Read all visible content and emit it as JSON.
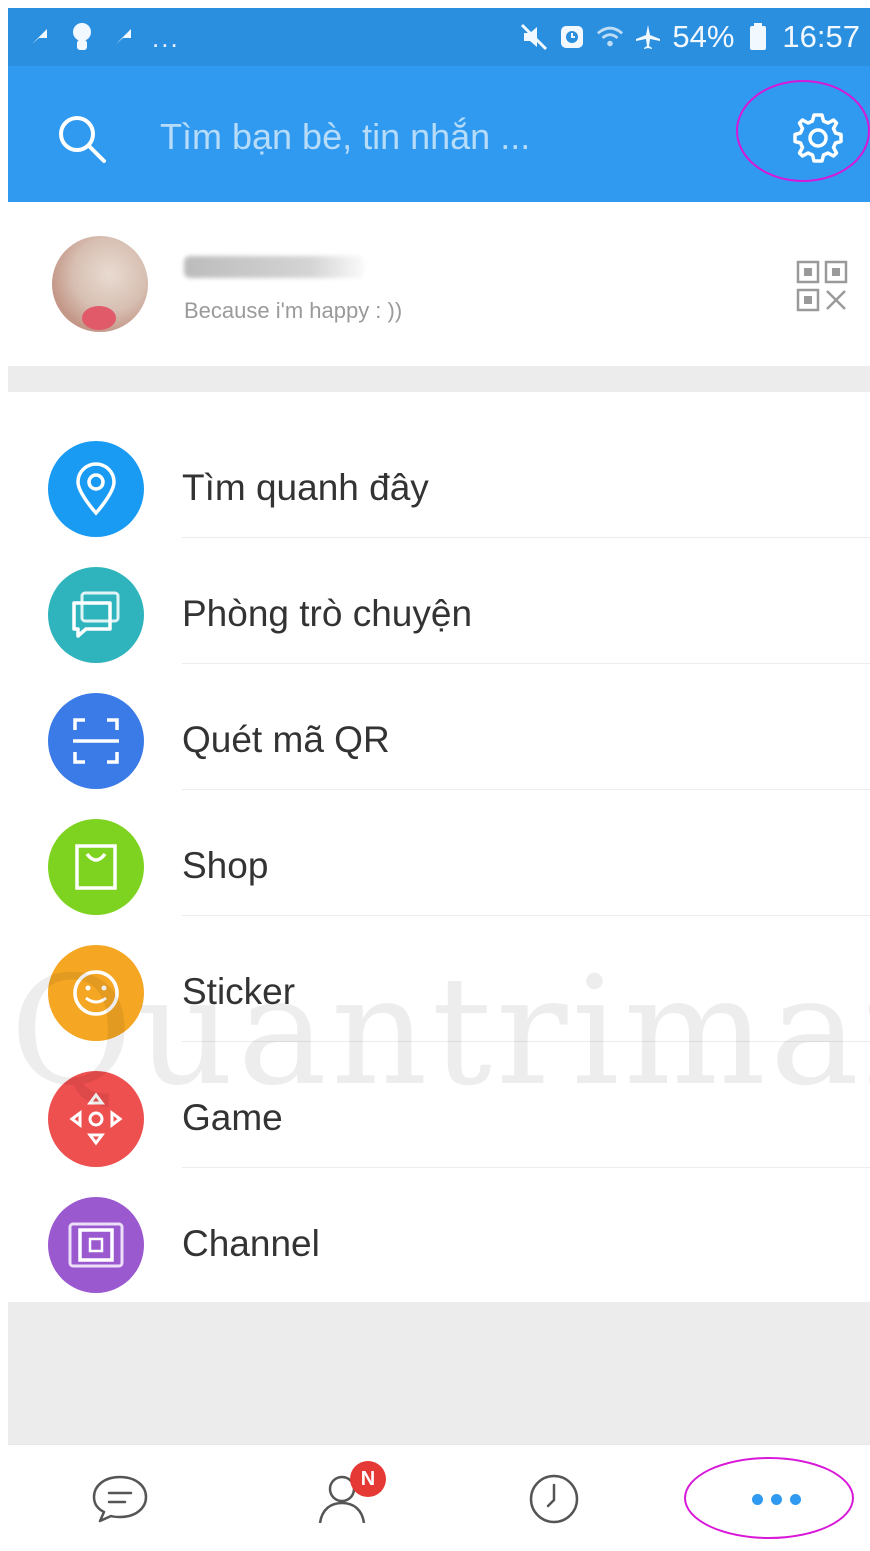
{
  "status_bar": {
    "overflow_dots": "...",
    "battery": "54%",
    "time": "16:57",
    "icons": [
      "notification-icon",
      "avatar-notification-icon",
      "notification-icon",
      "mute-icon",
      "alarm-icon",
      "wifi-icon",
      "airplane-icon",
      "battery-icon"
    ]
  },
  "header": {
    "search_placeholder": "Tìm bạn bè, tin nhắn ...",
    "icons": [
      "search-icon",
      "gear-icon"
    ]
  },
  "profile": {
    "status": "Because i'm happy : ))",
    "icons": [
      "qr-code-icon"
    ]
  },
  "menu": {
    "items": [
      {
        "label": "Tìm quanh đây",
        "icon": "location-pin-icon",
        "color": "#1a9bf3"
      },
      {
        "label": "Phòng trò chuyện",
        "icon": "chat-rooms-icon",
        "color": "#2fb3bd"
      },
      {
        "label": "Quét mã QR",
        "icon": "scan-icon",
        "color": "#3a7be8"
      },
      {
        "label": "Shop",
        "icon": "shopping-bag-icon",
        "color": "#7ed321"
      },
      {
        "label": "Sticker",
        "icon": "smiley-icon",
        "color": "#f5a623"
      },
      {
        "label": "Game",
        "icon": "gamepad-icon",
        "color": "#ee4f4f"
      },
      {
        "label": "Channel",
        "icon": "video-channel-icon",
        "color": "#9b59d0"
      }
    ]
  },
  "watermark": "Quantrimang",
  "bottom_nav": {
    "contacts_badge": "N",
    "icons": [
      "messages-icon",
      "contacts-icon",
      "timeline-clock-icon",
      "more-icon"
    ],
    "accent": "#2f9af0"
  },
  "colors": {
    "header": "#2f9af0",
    "status_bar": "#2b8fe0",
    "annotation": "#d817d8",
    "badge": "#e53935"
  }
}
